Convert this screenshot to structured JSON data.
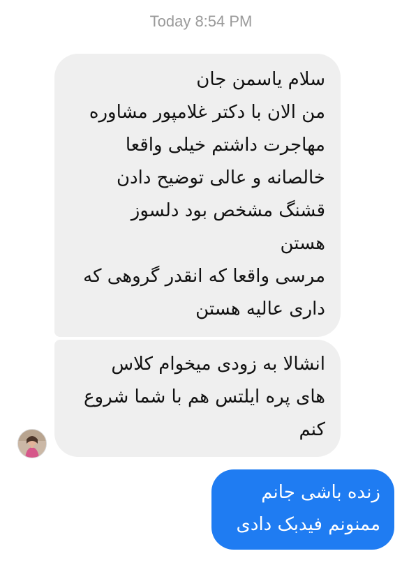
{
  "chat": {
    "timestamp": "Today 8:54 PM",
    "messages": [
      {
        "sender": "contact",
        "text": "سلام یاسمن جان\nمن الان با دکتر غلامپور مشاوره\nمهاجرت داشتم خیلی واقعا\nخالصانه و عالی توضیح دادن\nقشنگ مشخص بود دلسوز\nهستن\nمرسی واقعا که انقدر گروهی که\nداری عالیه هستن"
      },
      {
        "sender": "contact",
        "text": "انشالا به زودی میخوام کلاس\nهای پره ایلتس هم با شما شروع\nکنم"
      },
      {
        "sender": "me",
        "text": "زنده باشی جانم\nممنونم فیدبک دادی"
      }
    ],
    "avatar_icon": "contact-avatar",
    "colors": {
      "incoming_bubble": "#efefef",
      "outgoing_bubble": "#1f7cf2",
      "timestamp_text": "#9a9a9a"
    }
  }
}
